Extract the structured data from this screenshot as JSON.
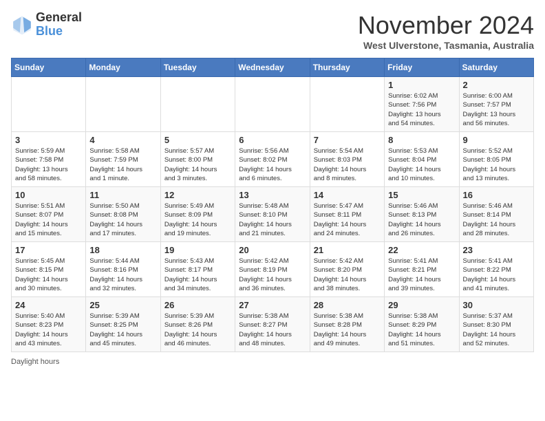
{
  "header": {
    "logo_general": "General",
    "logo_blue": "Blue",
    "month_title": "November 2024",
    "subtitle": "West Ulverstone, Tasmania, Australia"
  },
  "days_of_week": [
    "Sunday",
    "Monday",
    "Tuesday",
    "Wednesday",
    "Thursday",
    "Friday",
    "Saturday"
  ],
  "weeks": [
    [
      {
        "day": "",
        "info": ""
      },
      {
        "day": "",
        "info": ""
      },
      {
        "day": "",
        "info": ""
      },
      {
        "day": "",
        "info": ""
      },
      {
        "day": "",
        "info": ""
      },
      {
        "day": "1",
        "info": "Sunrise: 6:02 AM\nSunset: 7:56 PM\nDaylight: 13 hours\nand 54 minutes."
      },
      {
        "day": "2",
        "info": "Sunrise: 6:00 AM\nSunset: 7:57 PM\nDaylight: 13 hours\nand 56 minutes."
      }
    ],
    [
      {
        "day": "3",
        "info": "Sunrise: 5:59 AM\nSunset: 7:58 PM\nDaylight: 13 hours\nand 58 minutes."
      },
      {
        "day": "4",
        "info": "Sunrise: 5:58 AM\nSunset: 7:59 PM\nDaylight: 14 hours\nand 1 minute."
      },
      {
        "day": "5",
        "info": "Sunrise: 5:57 AM\nSunset: 8:00 PM\nDaylight: 14 hours\nand 3 minutes."
      },
      {
        "day": "6",
        "info": "Sunrise: 5:56 AM\nSunset: 8:02 PM\nDaylight: 14 hours\nand 6 minutes."
      },
      {
        "day": "7",
        "info": "Sunrise: 5:54 AM\nSunset: 8:03 PM\nDaylight: 14 hours\nand 8 minutes."
      },
      {
        "day": "8",
        "info": "Sunrise: 5:53 AM\nSunset: 8:04 PM\nDaylight: 14 hours\nand 10 minutes."
      },
      {
        "day": "9",
        "info": "Sunrise: 5:52 AM\nSunset: 8:05 PM\nDaylight: 14 hours\nand 13 minutes."
      }
    ],
    [
      {
        "day": "10",
        "info": "Sunrise: 5:51 AM\nSunset: 8:07 PM\nDaylight: 14 hours\nand 15 minutes."
      },
      {
        "day": "11",
        "info": "Sunrise: 5:50 AM\nSunset: 8:08 PM\nDaylight: 14 hours\nand 17 minutes."
      },
      {
        "day": "12",
        "info": "Sunrise: 5:49 AM\nSunset: 8:09 PM\nDaylight: 14 hours\nand 19 minutes."
      },
      {
        "day": "13",
        "info": "Sunrise: 5:48 AM\nSunset: 8:10 PM\nDaylight: 14 hours\nand 21 minutes."
      },
      {
        "day": "14",
        "info": "Sunrise: 5:47 AM\nSunset: 8:11 PM\nDaylight: 14 hours\nand 24 minutes."
      },
      {
        "day": "15",
        "info": "Sunrise: 5:46 AM\nSunset: 8:13 PM\nDaylight: 14 hours\nand 26 minutes."
      },
      {
        "day": "16",
        "info": "Sunrise: 5:46 AM\nSunset: 8:14 PM\nDaylight: 14 hours\nand 28 minutes."
      }
    ],
    [
      {
        "day": "17",
        "info": "Sunrise: 5:45 AM\nSunset: 8:15 PM\nDaylight: 14 hours\nand 30 minutes."
      },
      {
        "day": "18",
        "info": "Sunrise: 5:44 AM\nSunset: 8:16 PM\nDaylight: 14 hours\nand 32 minutes."
      },
      {
        "day": "19",
        "info": "Sunrise: 5:43 AM\nSunset: 8:17 PM\nDaylight: 14 hours\nand 34 minutes."
      },
      {
        "day": "20",
        "info": "Sunrise: 5:42 AM\nSunset: 8:19 PM\nDaylight: 14 hours\nand 36 minutes."
      },
      {
        "day": "21",
        "info": "Sunrise: 5:42 AM\nSunset: 8:20 PM\nDaylight: 14 hours\nand 38 minutes."
      },
      {
        "day": "22",
        "info": "Sunrise: 5:41 AM\nSunset: 8:21 PM\nDaylight: 14 hours\nand 39 minutes."
      },
      {
        "day": "23",
        "info": "Sunrise: 5:41 AM\nSunset: 8:22 PM\nDaylight: 14 hours\nand 41 minutes."
      }
    ],
    [
      {
        "day": "24",
        "info": "Sunrise: 5:40 AM\nSunset: 8:23 PM\nDaylight: 14 hours\nand 43 minutes."
      },
      {
        "day": "25",
        "info": "Sunrise: 5:39 AM\nSunset: 8:25 PM\nDaylight: 14 hours\nand 45 minutes."
      },
      {
        "day": "26",
        "info": "Sunrise: 5:39 AM\nSunset: 8:26 PM\nDaylight: 14 hours\nand 46 minutes."
      },
      {
        "day": "27",
        "info": "Sunrise: 5:38 AM\nSunset: 8:27 PM\nDaylight: 14 hours\nand 48 minutes."
      },
      {
        "day": "28",
        "info": "Sunrise: 5:38 AM\nSunset: 8:28 PM\nDaylight: 14 hours\nand 49 minutes."
      },
      {
        "day": "29",
        "info": "Sunrise: 5:38 AM\nSunset: 8:29 PM\nDaylight: 14 hours\nand 51 minutes."
      },
      {
        "day": "30",
        "info": "Sunrise: 5:37 AM\nSunset: 8:30 PM\nDaylight: 14 hours\nand 52 minutes."
      }
    ]
  ],
  "footer": {
    "daylight_hours_label": "Daylight hours"
  }
}
